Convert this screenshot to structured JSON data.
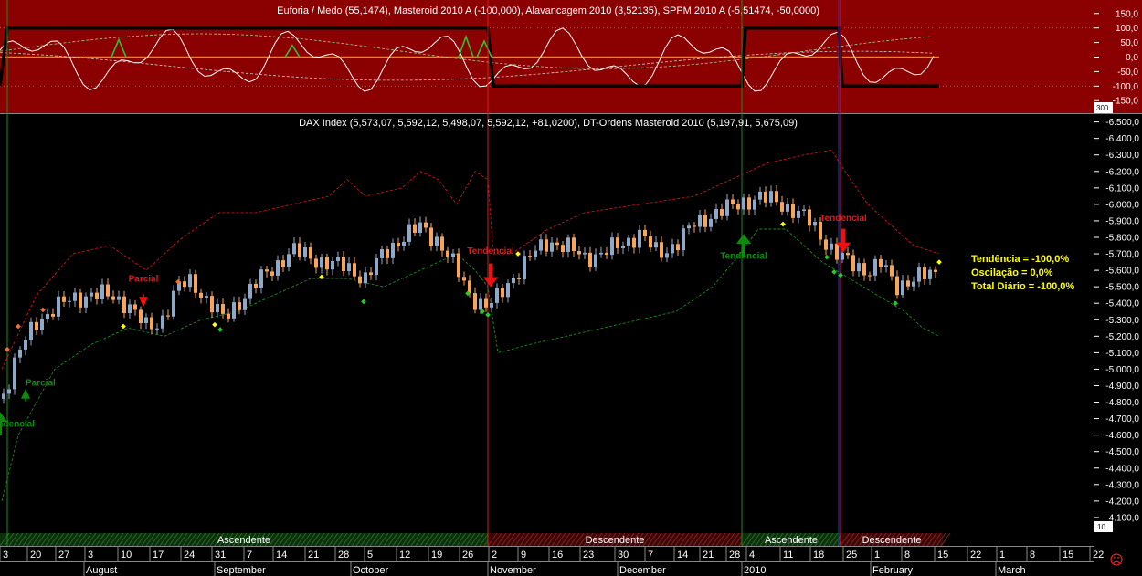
{
  "colors": {
    "top_bg": "#8b0000",
    "main_bg": "#000000",
    "axis_bg": "#000000",
    "up_candle": "#8fa8c8",
    "down_candle": "#f7a45c",
    "resistance": "#d01010",
    "support": "#1a8a1a",
    "stats": "#ffff00",
    "buy_arrow": "#0f8a0f",
    "sell_arrow": "#ee1111"
  },
  "top_panel": {
    "title": "Euforia / Medo (55,1474), Masteroid 2010 A (-100,000), Alavancagem 2010 (3,52135), SPPM 2010 A (-5,51474, -50,0000)",
    "ticks": [
      "150,0",
      "100,0",
      "50,0",
      "0,0",
      "-50,0",
      "-100,0",
      "-150,0"
    ],
    "tick_values": [
      150,
      100,
      50,
      0,
      -50,
      -100,
      -150
    ],
    "small_label": "300",
    "ylim": [
      -165,
      165
    ]
  },
  "main_panel": {
    "title": "DAX Index (5,573,07, 5,592,12, 5,498,07, 5,592,12, +81,0200), DT-Ordens Masteroid 2010 (5,197,91, 5,675,09)",
    "small_label": "10",
    "ylim": [
      3950,
      6520
    ]
  },
  "stats": {
    "tendencia": "Tendência = -100,0%",
    "oscilacao": "Oscilação = 0,0%",
    "total": "Total Diário = -100,0%"
  },
  "signals": [
    {
      "id": "buy1",
      "label": "Tendencial",
      "x": 0,
      "price": 4720,
      "type": "buy"
    },
    {
      "id": "buy2",
      "label": "Parcial",
      "x": 28,
      "price": 4860,
      "type": "buy-small"
    },
    {
      "id": "sell1",
      "label": "Parcial",
      "x": 157,
      "price": 5400,
      "type": "sell-small"
    },
    {
      "id": "sell2",
      "label": "Tendencial",
      "x": 537,
      "price": 5520,
      "type": "sell"
    },
    {
      "id": "buy3",
      "label": "Tendencial",
      "x": 814,
      "price": 5800,
      "type": "buy"
    },
    {
      "id": "sell3",
      "label": "Tendencial",
      "x": 923,
      "price": 5730,
      "type": "sell"
    }
  ],
  "phases": [
    {
      "label": "Ascendente",
      "x0": 0,
      "x1": 534,
      "type": "up"
    },
    {
      "label": "Descendente",
      "x0": 534,
      "x1": 812,
      "type": "down"
    },
    {
      "label": "Ascendente",
      "x0": 812,
      "x1": 920,
      "type": "up"
    },
    {
      "label": "Descendente",
      "x0": 920,
      "x1": 1032,
      "type": "down"
    }
  ],
  "x_axis": {
    "days": [
      {
        "label": "3",
        "x": 3
      },
      {
        "label": "20",
        "x": 33
      },
      {
        "label": "27",
        "x": 64
      },
      {
        "label": "3",
        "x": 96
      },
      {
        "label": "10",
        "x": 132
      },
      {
        "label": "17",
        "x": 167
      },
      {
        "label": "24",
        "x": 201
      },
      {
        "label": "31",
        "x": 235
      },
      {
        "label": "7",
        "x": 270
      },
      {
        "label": "14",
        "x": 302
      },
      {
        "label": "21",
        "x": 337
      },
      {
        "label": "28",
        "x": 370
      },
      {
        "label": "5",
        "x": 402
      },
      {
        "label": "12",
        "x": 437
      },
      {
        "label": "19",
        "x": 472
      },
      {
        "label": "26",
        "x": 506
      },
      {
        "label": "2",
        "x": 538
      },
      {
        "label": "9",
        "x": 570
      },
      {
        "label": "16",
        "x": 604
      },
      {
        "label": "23",
        "x": 638
      },
      {
        "label": "30",
        "x": 676
      },
      {
        "label": "7",
        "x": 709
      },
      {
        "label": "14",
        "x": 741
      },
      {
        "label": "21",
        "x": 769
      },
      {
        "label": "28",
        "x": 798
      },
      {
        "label": "4",
        "x": 820
      },
      {
        "label": "11",
        "x": 857
      },
      {
        "label": "18",
        "x": 890
      },
      {
        "label": "25",
        "x": 926
      },
      {
        "label": "1",
        "x": 957
      },
      {
        "label": "8",
        "x": 990
      },
      {
        "label": "15",
        "x": 1026
      },
      {
        "label": "22",
        "x": 1062
      },
      {
        "label": "1",
        "x": 1094
      },
      {
        "label": "8",
        "x": 1127
      },
      {
        "label": "15",
        "x": 1163
      },
      {
        "label": "22",
        "x": 1196
      }
    ],
    "months": [
      {
        "label": "August",
        "x": 92
      },
      {
        "label": "September",
        "x": 235
      },
      {
        "label": "October",
        "x": 384
      },
      {
        "label": "November",
        "x": 534
      },
      {
        "label": "December",
        "x": 676
      },
      {
        "label": "2010",
        "x": 812
      },
      {
        "label": "February",
        "x": 953
      },
      {
        "label": "March",
        "x": 1090
      }
    ]
  },
  "chart_data": [
    {
      "type": "line",
      "title": "Euforia / Medo (55,1474), Masteroid 2010 A (-100,000), Alavancagem 2010 (3,52135), SPPM 2010 A (-5,51474, -50,0000)",
      "ylim": [
        -150,
        150
      ],
      "series": [
        {
          "name": "Masteroid 2010 A",
          "values": [
            [
              0,
              -100
            ],
            [
              8,
              100
            ],
            [
              534,
              100
            ],
            [
              540,
              -100
            ],
            [
              812,
              -100
            ],
            [
              816,
              100
            ],
            [
              918,
              100
            ],
            [
              922,
              -100
            ],
            [
              1028,
              -100
            ]
          ]
        }
      ]
    },
    {
      "type": "candlestick",
      "title": "DAX Index (5,573,07, 5,592,12, 5,498,07, 5,592,12, +81,0200), DT-Ordens Masteroid 2010 (5,197,91, 5,675,09)",
      "ylim": [
        4000,
        6500
      ],
      "price_path": [
        [
          2,
          4820
        ],
        [
          20,
          5100
        ],
        [
          40,
          5280
        ],
        [
          60,
          5380
        ],
        [
          80,
          5420
        ],
        [
          100,
          5460
        ],
        [
          120,
          5440
        ],
        [
          140,
          5400
        ],
        [
          160,
          5250
        ],
        [
          175,
          5280
        ],
        [
          195,
          5500
        ],
        [
          210,
          5530
        ],
        [
          230,
          5400
        ],
        [
          245,
          5300
        ],
        [
          260,
          5400
        ],
        [
          280,
          5520
        ],
        [
          300,
          5620
        ],
        [
          320,
          5720
        ],
        [
          340,
          5680
        ],
        [
          360,
          5640
        ],
        [
          380,
          5620
        ],
        [
          400,
          5550
        ],
        [
          420,
          5700
        ],
        [
          440,
          5800
        ],
        [
          460,
          5860
        ],
        [
          480,
          5780
        ],
        [
          500,
          5600
        ],
        [
          515,
          5450
        ],
        [
          530,
          5380
        ],
        [
          540,
          5400
        ],
        [
          560,
          5550
        ],
        [
          580,
          5680
        ],
        [
          600,
          5780
        ],
        [
          620,
          5740
        ],
        [
          640,
          5680
        ],
        [
          660,
          5700
        ],
        [
          680,
          5760
        ],
        [
          700,
          5820
        ],
        [
          720,
          5700
        ],
        [
          740,
          5760
        ],
        [
          760,
          5880
        ],
        [
          780,
          5940
        ],
        [
          800,
          5980
        ],
        [
          815,
          6020
        ],
        [
          830,
          6040
        ],
        [
          850,
          6020
        ],
        [
          870,
          5960
        ],
        [
          885,
          5900
        ],
        [
          900,
          5800
        ],
        [
          915,
          5700
        ],
        [
          930,
          5640
        ],
        [
          950,
          5600
        ],
        [
          965,
          5640
        ],
        [
          980,
          5500
        ],
        [
          995,
          5540
        ],
        [
          1010,
          5560
        ],
        [
          1028,
          5592
        ]
      ],
      "resistance_path": [
        [
          2,
          5000
        ],
        [
          40,
          5450
        ],
        [
          80,
          5700
        ],
        [
          120,
          5750
        ],
        [
          160,
          5600
        ],
        [
          200,
          5800
        ],
        [
          240,
          5950
        ],
        [
          280,
          5950
        ],
        [
          320,
          6000
        ],
        [
          360,
          6050
        ],
        [
          380,
          6150
        ],
        [
          400,
          6050
        ],
        [
          440,
          6100
        ],
        [
          460,
          6200
        ],
        [
          480,
          6150
        ],
        [
          500,
          6000
        ],
        [
          520,
          6200
        ],
        [
          534,
          6150
        ],
        [
          540,
          5700
        ],
        [
          560,
          5700
        ],
        [
          600,
          5850
        ],
        [
          640,
          5950
        ],
        [
          700,
          6000
        ],
        [
          760,
          6050
        ],
        [
          800,
          6150
        ],
        [
          840,
          6250
        ],
        [
          880,
          6300
        ],
        [
          910,
          6330
        ],
        [
          925,
          6200
        ],
        [
          950,
          6000
        ],
        [
          980,
          5850
        ],
        [
          1000,
          5750
        ],
        [
          1028,
          5700
        ]
      ],
      "support_path": [
        [
          2,
          4200
        ],
        [
          20,
          4600
        ],
        [
          60,
          5000
        ],
        [
          100,
          5150
        ],
        [
          140,
          5250
        ],
        [
          180,
          5200
        ],
        [
          220,
          5300
        ],
        [
          260,
          5350
        ],
        [
          300,
          5450
        ],
        [
          340,
          5550
        ],
        [
          380,
          5550
        ],
        [
          420,
          5500
        ],
        [
          460,
          5600
        ],
        [
          500,
          5700
        ],
        [
          520,
          5600
        ],
        [
          534,
          5500
        ],
        [
          545,
          5100
        ],
        [
          580,
          5150
        ],
        [
          620,
          5200
        ],
        [
          660,
          5250
        ],
        [
          700,
          5300
        ],
        [
          740,
          5350
        ],
        [
          780,
          5500
        ],
        [
          810,
          5700
        ],
        [
          830,
          5850
        ],
        [
          860,
          5850
        ],
        [
          900,
          5650
        ],
        [
          930,
          5550
        ],
        [
          960,
          5450
        ],
        [
          990,
          5350
        ],
        [
          1010,
          5250
        ],
        [
          1028,
          5200
        ]
      ]
    }
  ]
}
